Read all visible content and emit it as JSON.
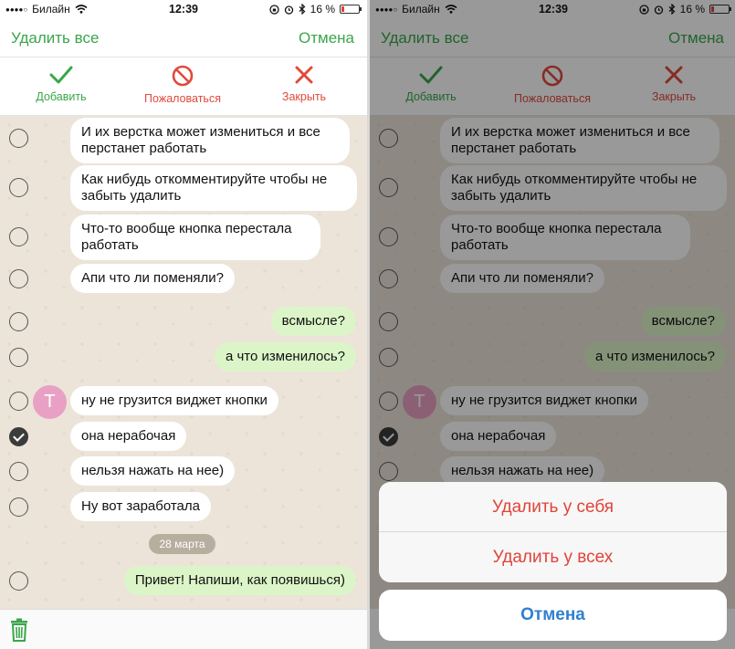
{
  "status_bar": {
    "signal": "●●●●○",
    "carrier": "Билайн",
    "time": "12:39",
    "battery_percent": "16 %"
  },
  "nav": {
    "delete_all": "Удалить все",
    "cancel": "Отмена"
  },
  "actions": {
    "add": "Добавить",
    "report": "Пожаловаться",
    "close": "Закрыть"
  },
  "messages": [
    {
      "text": "И их верстка может измениться и все перстанет работать",
      "dir": "in",
      "checked": false
    },
    {
      "text": "Как нибудь откомментируйте чтобы не забыть удалить",
      "dir": "in",
      "checked": false
    },
    {
      "text": "Что-то вообще кнопка перестала работать",
      "dir": "in",
      "checked": false
    },
    {
      "text": "Апи что ли поменяли?",
      "dir": "in",
      "checked": false
    },
    {
      "text": "всмысле?",
      "dir": "out",
      "checked": false
    },
    {
      "text": "а что изменилось?",
      "dir": "out",
      "checked": false
    },
    {
      "text": "ну не грузится виджет кнопки",
      "dir": "in",
      "checked": false,
      "avatar": "T"
    },
    {
      "text": "она нерабочая",
      "dir": "in",
      "checked": true
    },
    {
      "text": "нельзя нажать на нее)",
      "dir": "in",
      "checked": false
    },
    {
      "text": "Ну вот заработала",
      "dir": "in",
      "checked": false
    },
    {
      "text": "Привет! Напиши, как появишься)",
      "dir": "out",
      "checked": false
    }
  ],
  "date_chip": "28 марта",
  "action_sheet": {
    "delete_for_me": "Удалить у себя",
    "delete_for_all": "Удалить у всех",
    "cancel": "Отмена"
  },
  "colors": {
    "accent_green": "#3aa64a",
    "destructive_red": "#e0443a",
    "cancel_blue": "#2f7fd0",
    "bubble_in": "#ffffff",
    "bubble_out": "#dcf5c8",
    "chat_background": "#ece4d9"
  },
  "icons": {
    "add": "checkmark-icon",
    "report": "prohibited-icon",
    "close": "cross-icon",
    "delete": "trash-icon"
  }
}
